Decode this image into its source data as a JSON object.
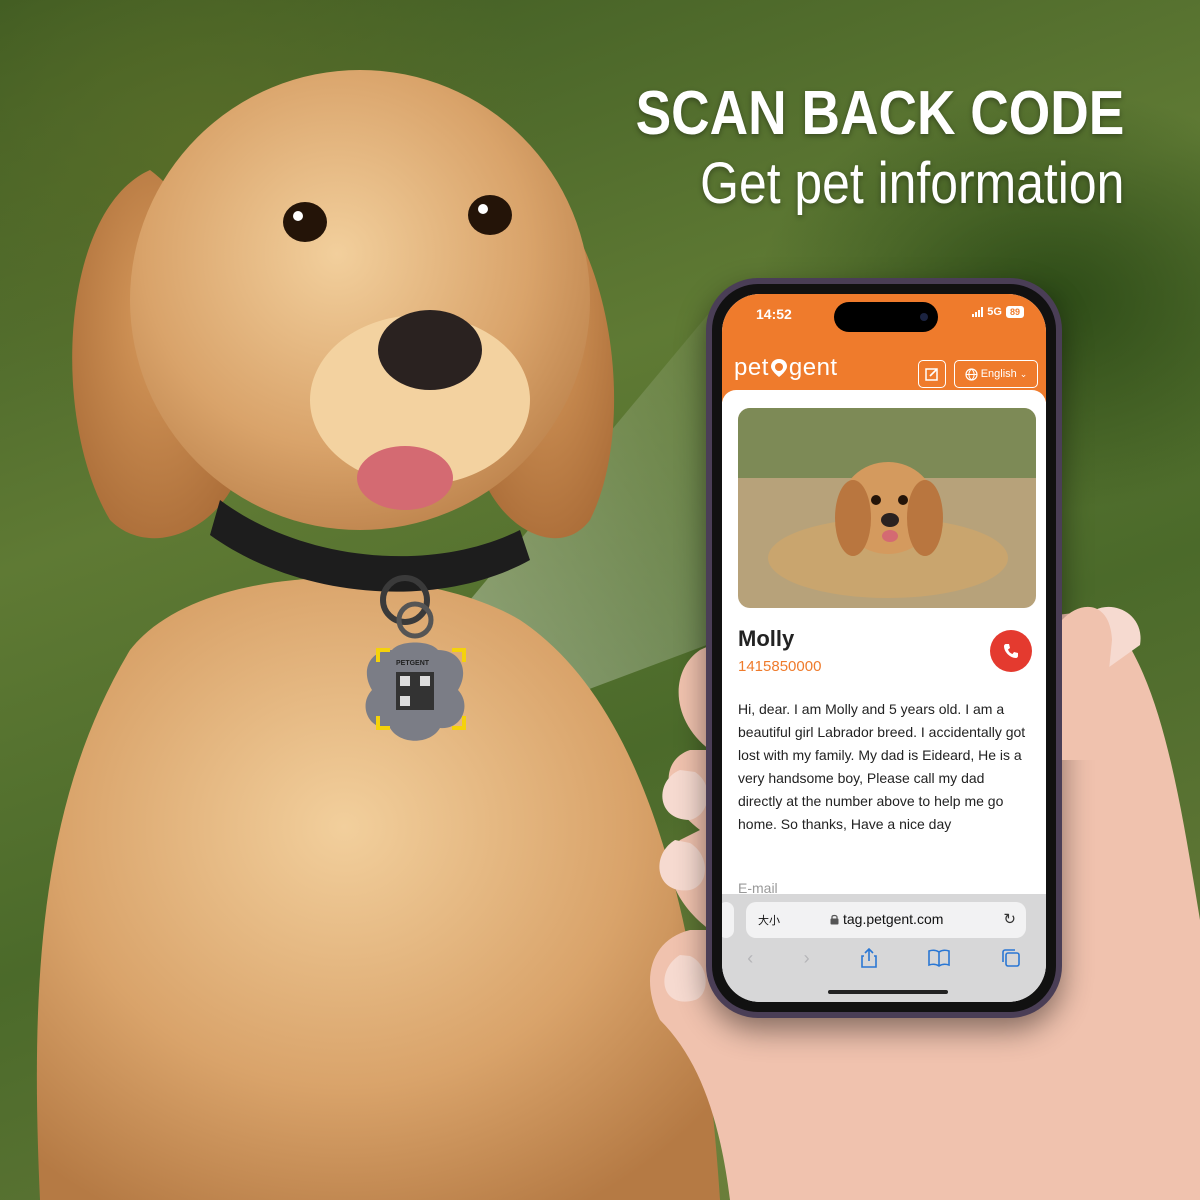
{
  "headline": {
    "line1": "SCAN BACK CODE",
    "line2": "Get pet information"
  },
  "tag": {
    "brand": "PETGENT"
  },
  "phone": {
    "status": {
      "time": "14:52",
      "network": "5G",
      "battery": "89"
    },
    "app": {
      "logo_text_left": "pet",
      "logo_text_right": "gent",
      "language": "English",
      "edit_icon": "edit-square-icon",
      "language_icon": "globe-icon"
    },
    "pet": {
      "name": "Molly",
      "phone": "1415850000",
      "bio": "Hi, dear. I am Molly and 5 years old. I am a beautiful girl Labrador breed. I accidentally got lost with my family. My dad is Eideard, He is a very handsome boy,  Please call my dad directly at the number above to help me go home. So thanks, Have a nice day",
      "email_label": "E-mail"
    },
    "browser": {
      "text_size": "大小",
      "url": "tag.petgent.com"
    }
  },
  "colors": {
    "brand": "#ef7b2c",
    "call": "#e43a2f",
    "link": "#2a77d4"
  }
}
